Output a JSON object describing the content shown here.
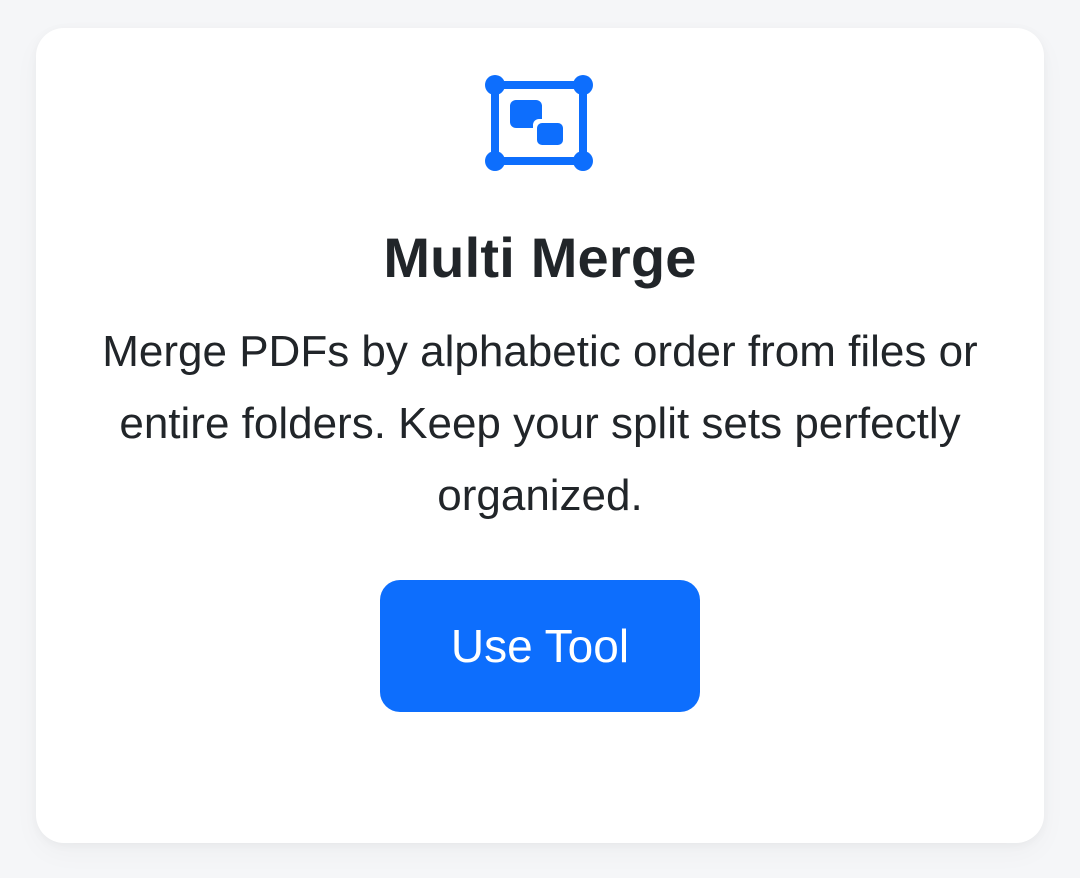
{
  "card": {
    "icon": "multi-merge-icon",
    "title": "Multi Merge",
    "description": "Merge PDFs by alphabetic order from files or entire folders. Keep your split sets perfectly organized.",
    "button_label": "Use Tool"
  },
  "colors": {
    "accent": "#0d6efd",
    "text": "#212529",
    "card_background": "#ffffff",
    "page_background": "#f5f6f8"
  }
}
